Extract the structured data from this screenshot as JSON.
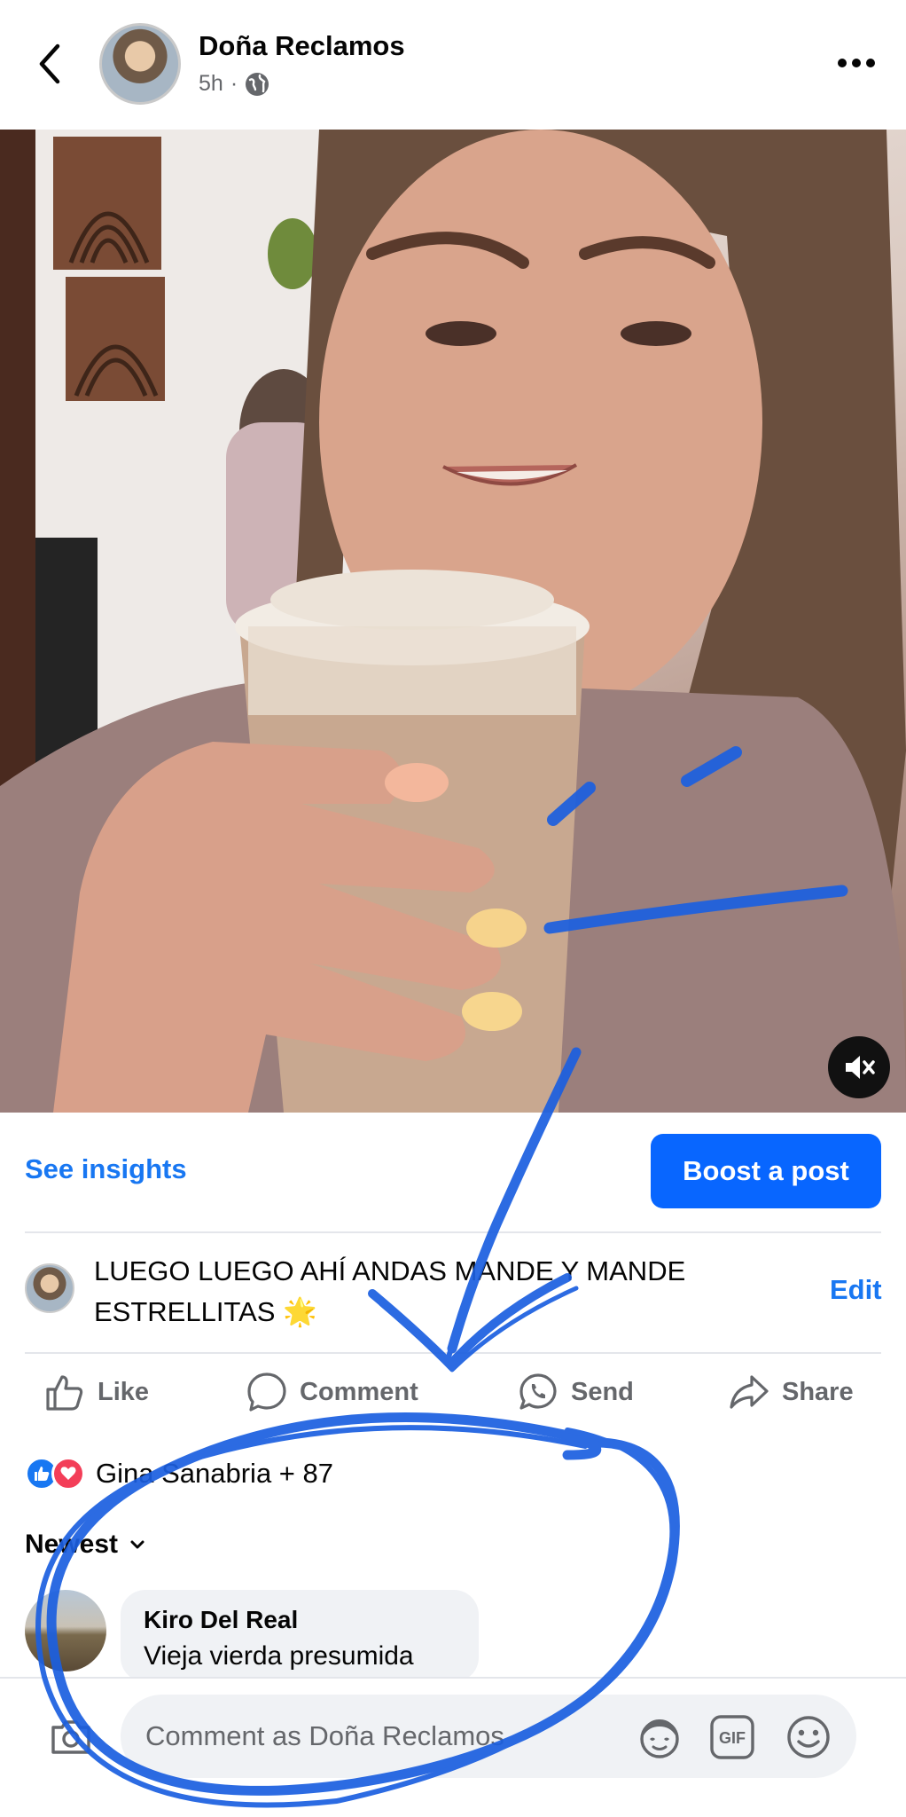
{
  "header": {
    "author": "Doña Reclamos",
    "time": "5h",
    "separator": "·"
  },
  "icons": {
    "back": "chevron-left-icon",
    "audience": "globe-icon",
    "more": "more-horizontal-icon",
    "mute": "muted-speaker-icon",
    "like": "thumbs-up-icon",
    "comment": "comment-bubble-icon",
    "send": "whatsapp-icon",
    "share": "share-arrow-icon",
    "sort": "chevron-down-icon",
    "camera": "camera-icon",
    "avatar_sticker": "avatar-sticker-icon",
    "gif": "gif-icon",
    "emoji": "smiley-icon"
  },
  "post": {
    "insights_label": "See insights",
    "boost_label": "Boost a post",
    "caption": "LUEGO LUEGO AHÍ ANDAS MANDE Y MANDE ESTRELLITAS 🌟",
    "edit_label": "Edit"
  },
  "actions": {
    "like": "Like",
    "comment": "Comment",
    "send": "Send",
    "share": "Share"
  },
  "reactions": {
    "summary": "Gina Sanabria + 87"
  },
  "comments": {
    "sort_label": "Newest",
    "items": [
      {
        "author": "Kiro Del Real",
        "text": "Vieja vierda presumida"
      }
    ]
  },
  "composer": {
    "placeholder": "Comment as Doña Reclamos",
    "gif_label": "GIF"
  },
  "colors": {
    "brand_blue": "#1877f2",
    "boost_blue": "#0866ff",
    "annotation_blue": "#1b5fe0",
    "love_red": "#f33e58",
    "secondary_text": "#65676b"
  }
}
